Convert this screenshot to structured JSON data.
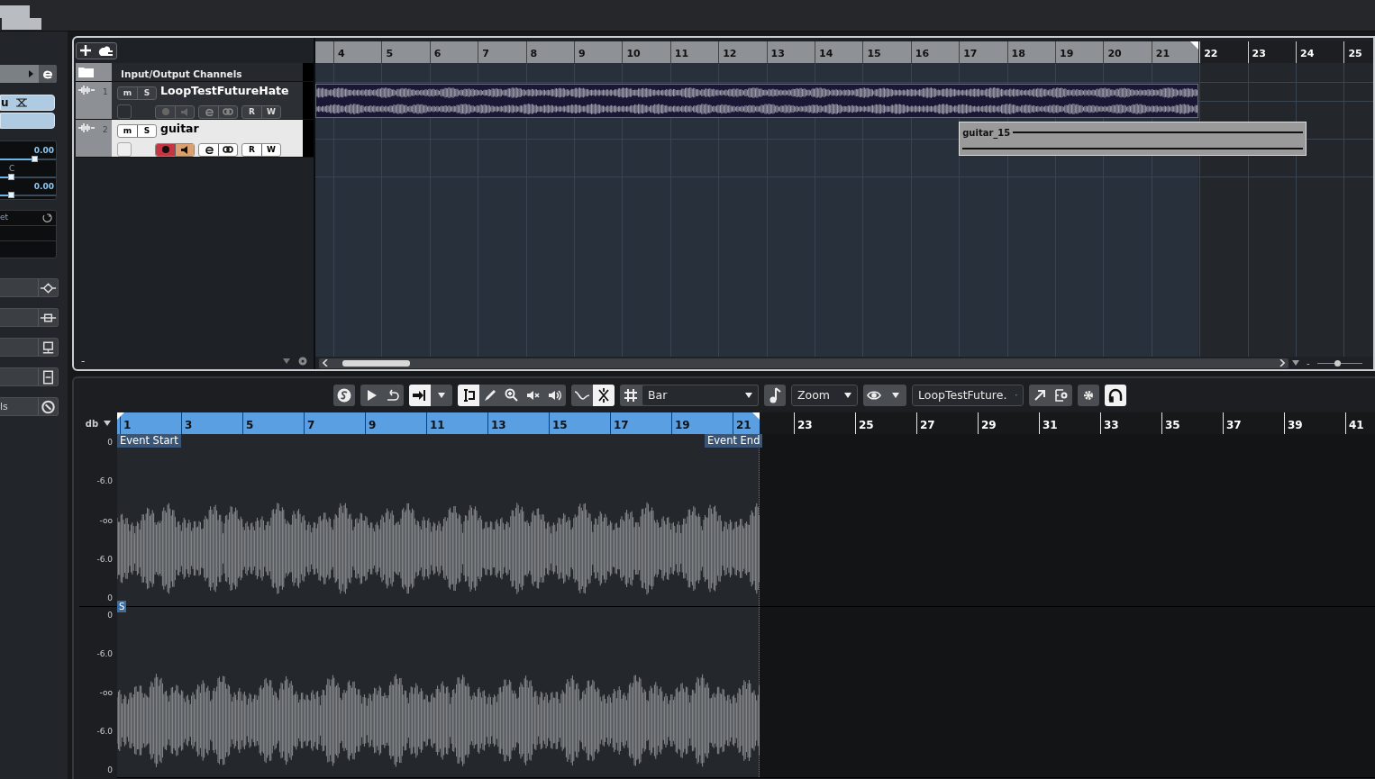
{
  "inspector": {
    "lane_button": "u",
    "volume": {
      "value": "0.00",
      "level": 0.62
    },
    "pan": {
      "value": "C",
      "level": 0.19
    },
    "slider_3": {
      "value": "0.00",
      "level": 0.19
    },
    "section_label": "et",
    "row_label": "ls"
  },
  "project": {
    "ruler": [
      "4",
      "5",
      "6",
      "7",
      "8",
      "9",
      "10",
      "11",
      "12",
      "13",
      "14",
      "15",
      "16",
      "17",
      "18",
      "19",
      "20",
      "21",
      "22",
      "23",
      "24",
      "25"
    ],
    "folder_track": {
      "name": "Input/Output Channels"
    },
    "tracks": [
      {
        "number": "1",
        "name": "LoopTestFutureHate",
        "selected": false,
        "record": false,
        "monitor": false,
        "controls": [
          "m",
          "S",
          "R",
          "W"
        ]
      },
      {
        "number": "2",
        "name": "guitar",
        "selected": true,
        "record": true,
        "monitor": true,
        "controls": [
          "m",
          "S",
          "R",
          "W"
        ],
        "event_label": "guitar_15"
      }
    ],
    "footer_minus": "-",
    "zoom_minus": "-",
    "zoom_slider": {
      "level": 0.45
    }
  },
  "editor": {
    "toolbar": [
      {
        "items": [
          {
            "kind": "button",
            "selected": false
          }
        ]
      },
      {
        "items": [
          {
            "kind": "button",
            "selected": false
          },
          {
            "kind": "button",
            "selected": false
          }
        ]
      },
      {
        "items": [
          {
            "kind": "button",
            "selected": true
          },
          {
            "kind": "button",
            "selected": false
          }
        ]
      },
      {
        "items": [
          {
            "kind": "button",
            "selected": true
          },
          {
            "kind": "button",
            "selected": false
          },
          {
            "kind": "button",
            "selected": false
          },
          {
            "kind": "button",
            "selected": false
          },
          {
            "kind": "button",
            "selected": false
          }
        ]
      },
      {
        "items": [
          {
            "kind": "button",
            "selected": false
          },
          {
            "kind": "button",
            "selected": true
          }
        ]
      },
      {
        "items": [
          {
            "kind": "button",
            "selected": false
          },
          {
            "kind": "dropdown",
            "value": "Bar"
          }
        ]
      },
      {
        "items": [
          {
            "kind": "button",
            "selected": false
          }
        ]
      },
      {
        "items": [
          {
            "kind": "dropdown",
            "value": "Zoom"
          }
        ]
      },
      {
        "items": [
          {
            "kind": "button",
            "selected": false
          },
          {
            "kind": "button",
            "selected": false
          }
        ]
      },
      {
        "items": [
          {
            "kind": "dropdown",
            "value": "LoopTestFuture."
          }
        ]
      },
      {
        "items": [
          {
            "kind": "button",
            "selected": false
          },
          {
            "kind": "button",
            "selected": false
          }
        ]
      },
      {
        "items": [
          {
            "kind": "button",
            "selected": false
          }
        ]
      },
      {
        "items": [
          {
            "kind": "button",
            "selected": true
          }
        ]
      }
    ],
    "db_label": "db",
    "ruler": [
      "1",
      "3",
      "5",
      "7",
      "9",
      "11",
      "13",
      "15",
      "17",
      "19",
      "21",
      "23",
      "25",
      "27",
      "29",
      "31",
      "33",
      "35",
      "37",
      "39",
      "41"
    ],
    "event_start": "Event Start",
    "event_end": "Event End",
    "marker": "S",
    "channels": [
      {
        "scale": [
          "0",
          "-6.0",
          "-oo",
          "-6.0",
          "0"
        ]
      },
      {
        "scale": [
          "0",
          "-6.0",
          "-oo",
          "-6.0",
          "0"
        ]
      }
    ]
  }
}
